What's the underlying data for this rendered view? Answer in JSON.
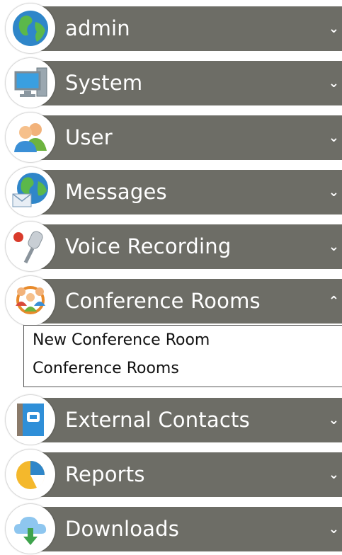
{
  "menu": {
    "items": [
      {
        "label": "admin",
        "icon": "globe-icon",
        "expanded": false
      },
      {
        "label": "System",
        "icon": "computer-icon",
        "expanded": false
      },
      {
        "label": "User",
        "icon": "users-icon",
        "expanded": false
      },
      {
        "label": "Messages",
        "icon": "globe-mail-icon",
        "expanded": false
      },
      {
        "label": "Voice Recording",
        "icon": "microphone-icon",
        "expanded": false
      },
      {
        "label": "Conference Rooms",
        "icon": "conference-icon",
        "expanded": true
      },
      {
        "label": "External Contacts",
        "icon": "phonebook-icon",
        "expanded": false
      },
      {
        "label": "Reports",
        "icon": "pie-chart-icon",
        "expanded": false
      },
      {
        "label": "Downloads",
        "icon": "cloud-download-icon",
        "expanded": false
      }
    ],
    "chevron_collapsed": "⌄",
    "chevron_expanded": "⌃"
  },
  "conference_submenu": {
    "links": [
      "New Conference Room",
      "Conference Rooms"
    ]
  },
  "colors": {
    "bar": "#6d6d66",
    "bar_text": "#ffffff"
  }
}
